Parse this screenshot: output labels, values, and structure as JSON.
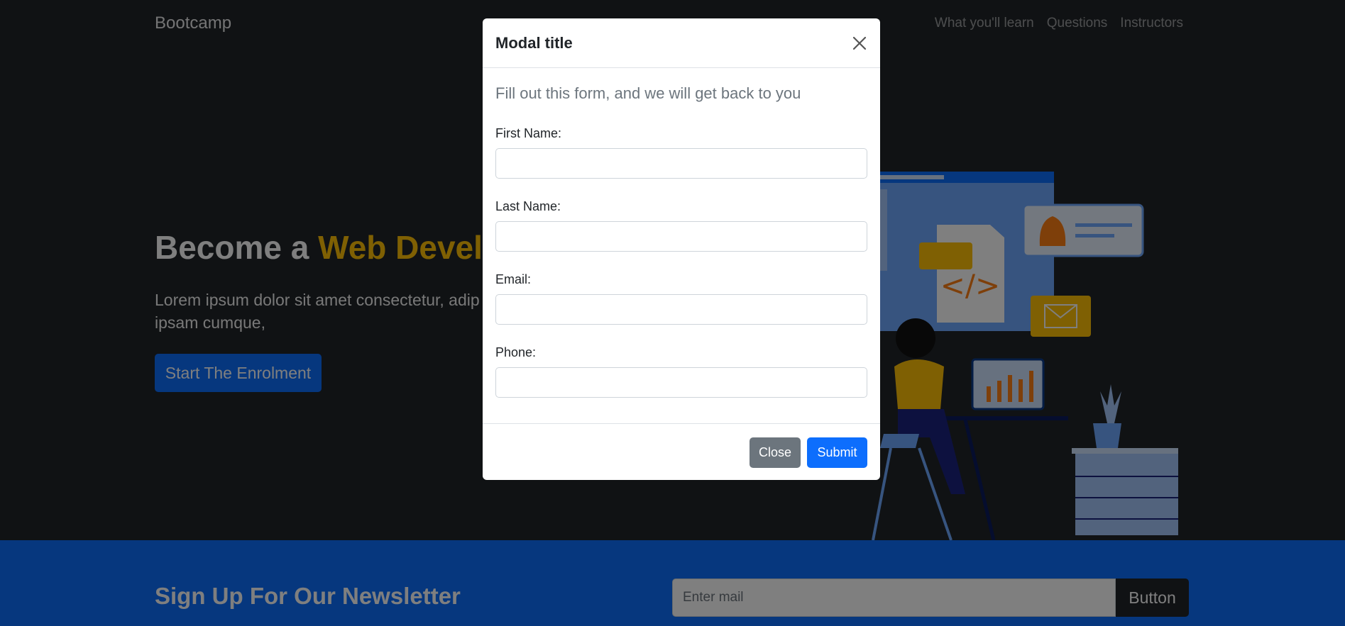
{
  "navbar": {
    "brand": "Bootcamp",
    "links": [
      "What you'll learn",
      "Questions",
      "Instructors"
    ]
  },
  "hero": {
    "title_plain": "Become a ",
    "title_accent": "Web Develop",
    "text": "Lorem ipsum dolor sit amet consectetur, adip enim ipsam cumque,",
    "button": "Start The Enrolment"
  },
  "newsletter": {
    "title": "Sign Up For Our Newsletter",
    "input_placeholder": "Enter mail",
    "button": "Button"
  },
  "modal": {
    "title": "Modal title",
    "intro": "Fill out this form, and we will get back to you",
    "fields": [
      {
        "label": "First Name:",
        "value": ""
      },
      {
        "label": "Last Name:",
        "value": ""
      },
      {
        "label": "Email:",
        "value": ""
      },
      {
        "label": "Phone:",
        "value": ""
      }
    ],
    "close_button": "Close",
    "submit_button": "Submit"
  },
  "colors": {
    "dark": "#212529",
    "primary": "#0d6efd",
    "warning": "#ffc107",
    "secondary": "#6c757d"
  },
  "icons": {
    "close": "close-icon",
    "illustration": "developer-workspace-illustration"
  }
}
